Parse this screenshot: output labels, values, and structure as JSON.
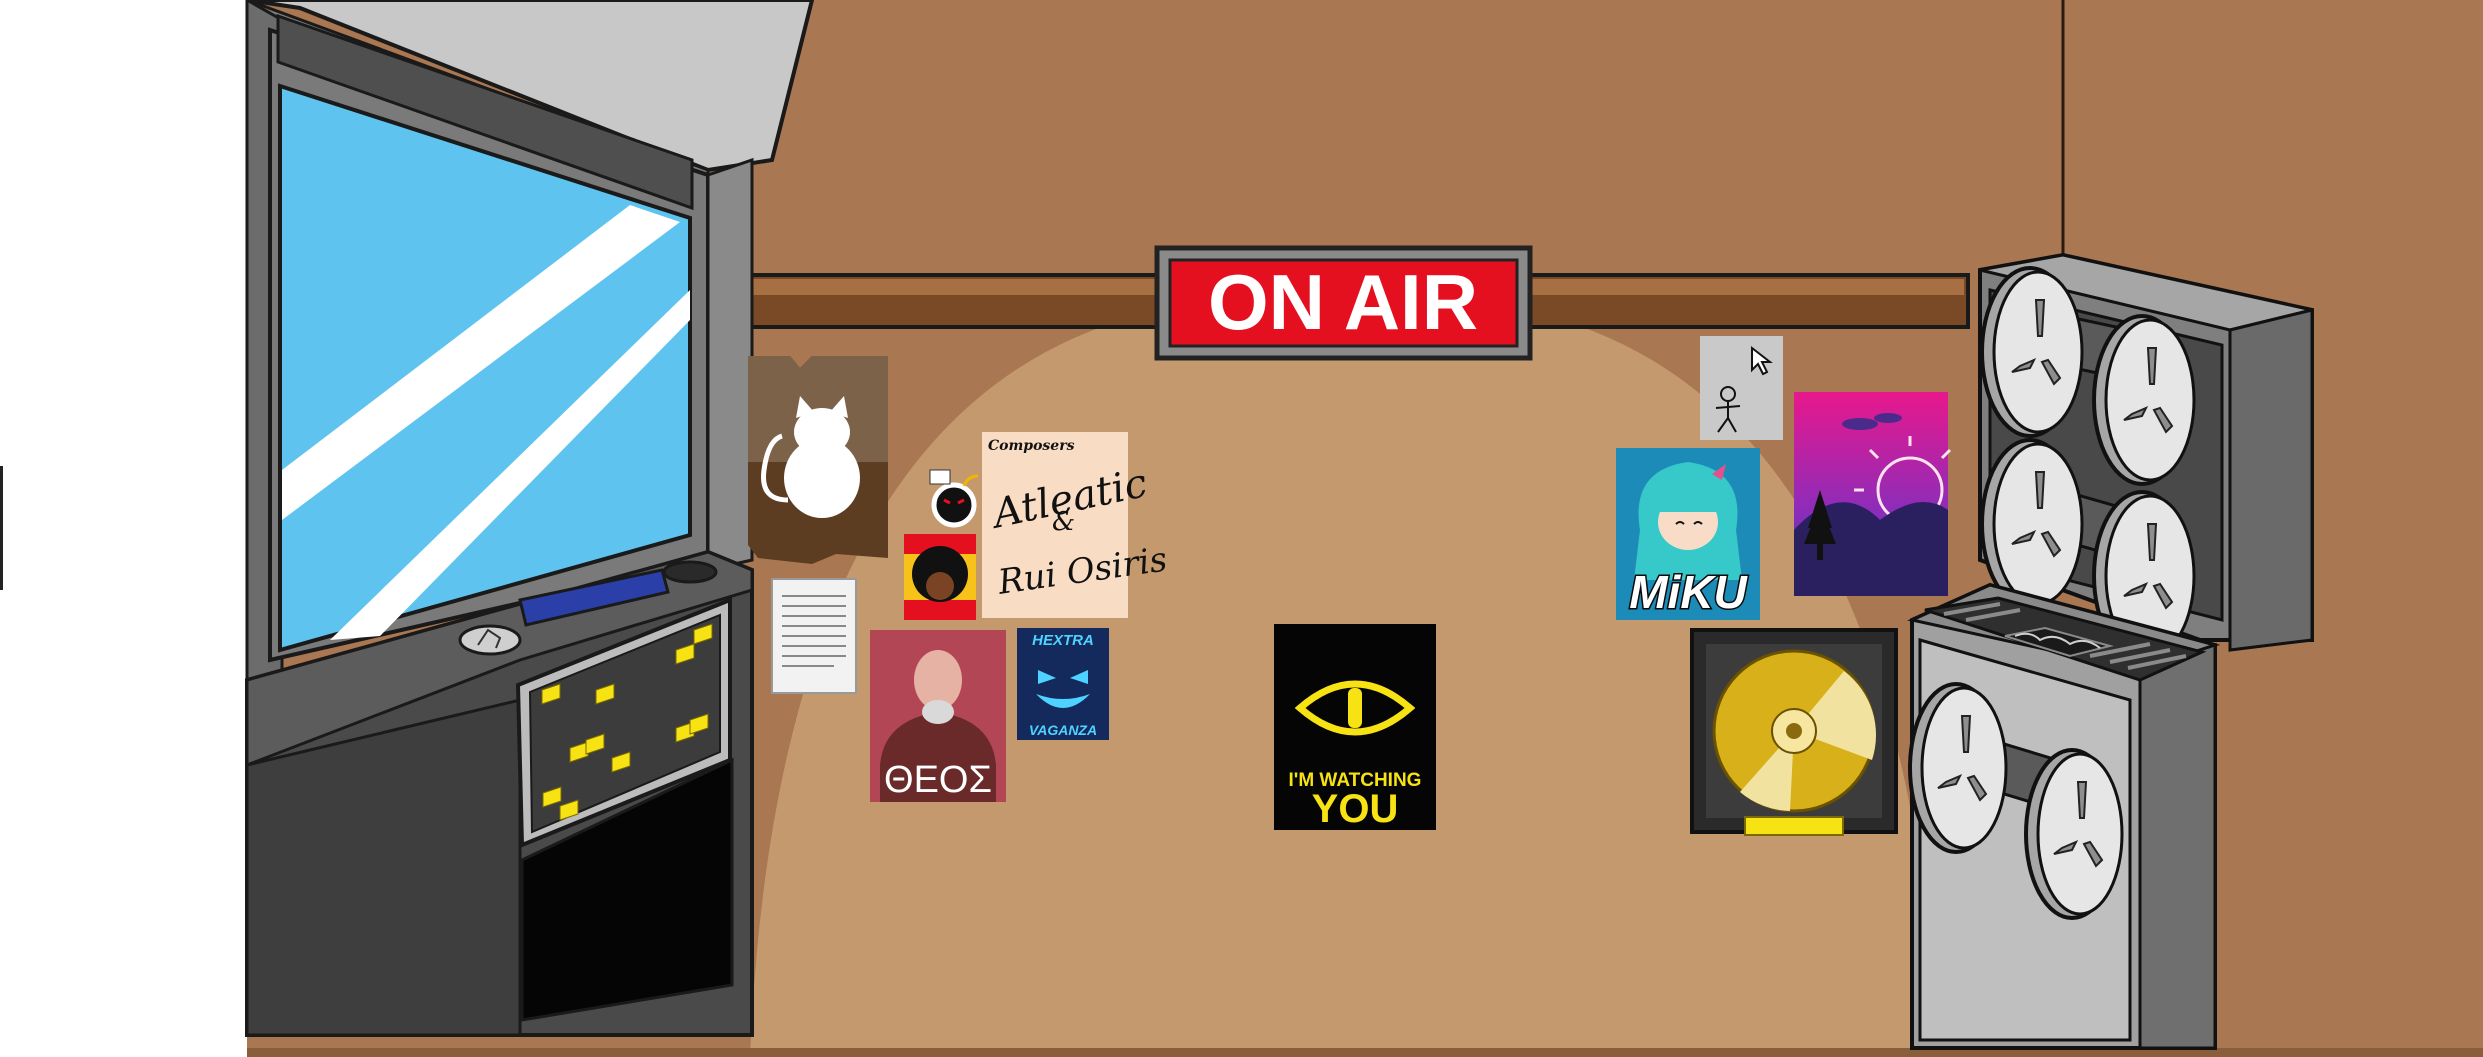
{
  "scene": {
    "description_colors": {
      "wall": "#a97752",
      "spotlight": "#c4996e",
      "shelf": "#7a4a26",
      "window_glass": "#5ec3ef",
      "sign_red": "#e5101f",
      "gold": "#d7b01a",
      "metal_light": "#bdbdbd",
      "metal_dark": "#4a4a4a",
      "yellow": "#f7e214"
    }
  },
  "sign": {
    "text": "ON AIR"
  },
  "posters": {
    "composers": {
      "header": "Composers",
      "line1": "Atleatic",
      "line2": "&",
      "line3": "Rui Osiris"
    },
    "theos": {
      "text": "ΘΕΟΣ"
    },
    "hextra": {
      "top": "HEXTRA",
      "bottom": "VAGANZA"
    },
    "watching": {
      "line1": "I'M WATCHING",
      "line2": "YOU"
    },
    "miku": {
      "text": "MiKU"
    }
  }
}
